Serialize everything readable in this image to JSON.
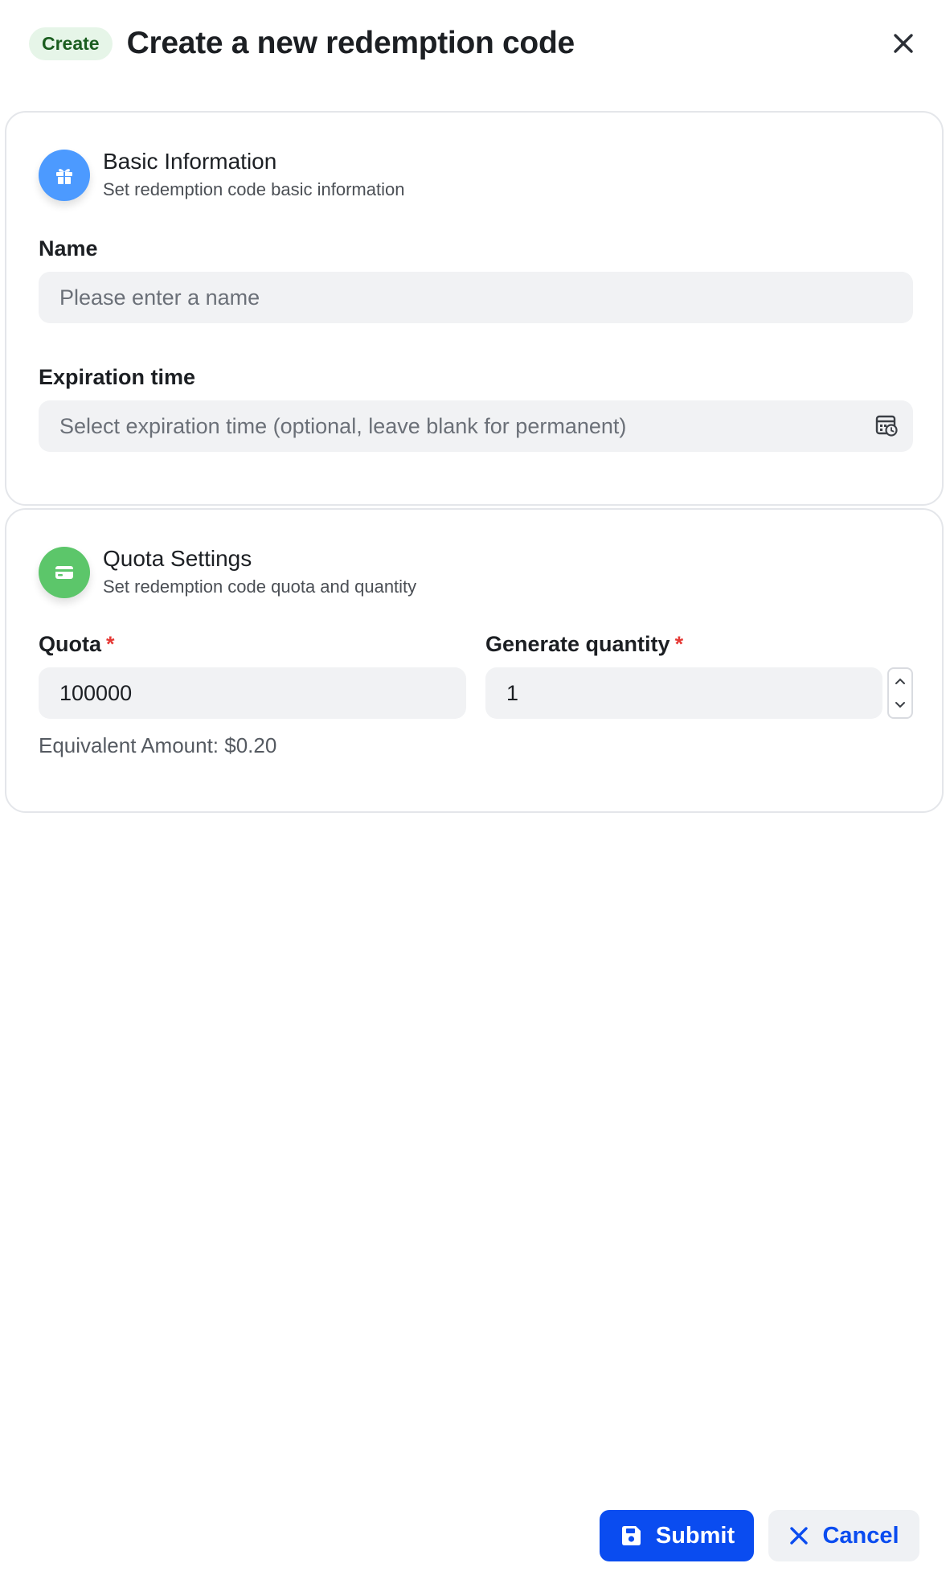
{
  "header": {
    "badge": "Create",
    "title": "Create a new redemption code"
  },
  "basic_info": {
    "title": "Basic Information",
    "subtitle": "Set redemption code basic information",
    "icon": "gift-icon",
    "icon_color": "#4c9aff",
    "name_label": "Name",
    "name_placeholder": "Please enter a name",
    "expiration_label": "Expiration time",
    "expiration_placeholder": "Select expiration time (optional, leave blank for permanent)"
  },
  "quota_settings": {
    "title": "Quota Settings",
    "subtitle": "Set redemption code quota and quantity",
    "icon": "credit-card-icon",
    "icon_color": "#5cc66a",
    "quota_label": "Quota",
    "quota_required": "*",
    "quota_value": "100000",
    "equivalent_amount": "Equivalent Amount: $0.20",
    "quantity_label": "Generate quantity",
    "quantity_required": "*",
    "quantity_value": "1"
  },
  "footer": {
    "submit_label": "Submit",
    "cancel_label": "Cancel"
  },
  "colors": {
    "primary": "#0a4cf0",
    "badge_bg": "#e6f5e8",
    "required": "#e53935"
  }
}
